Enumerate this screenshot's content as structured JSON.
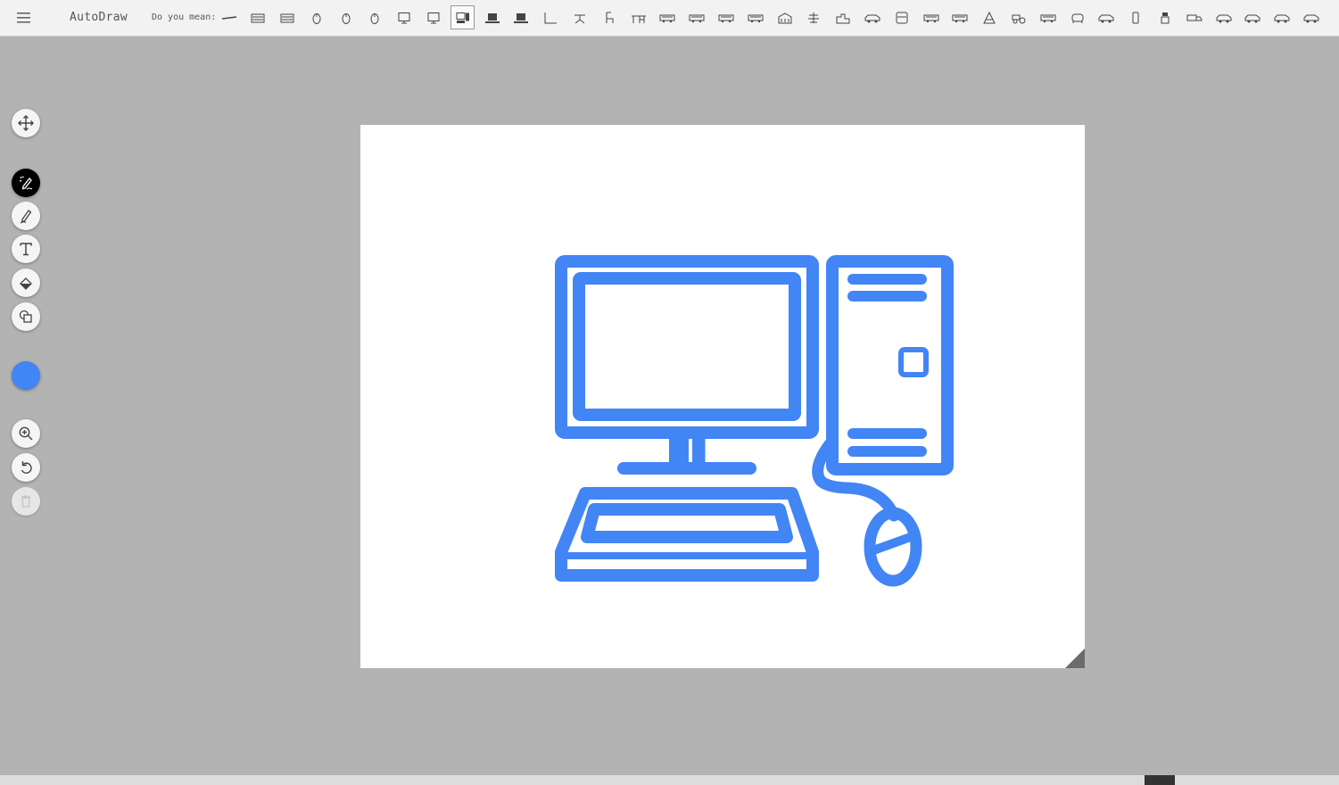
{
  "app": {
    "title": "AutoDraw",
    "menu_icon": "hamburger-menu-icon"
  },
  "suggestions": {
    "label": "Do you mean:",
    "items": [
      {
        "icon": "cable-icon"
      },
      {
        "icon": "keyboard-icon"
      },
      {
        "icon": "keyboard-icon"
      },
      {
        "icon": "mouse-icon"
      },
      {
        "icon": "mouse-icon"
      },
      {
        "icon": "mouse-icon"
      },
      {
        "icon": "monitor-icon"
      },
      {
        "icon": "monitor-icon"
      },
      {
        "icon": "desktop-computer-icon",
        "selected": true
      },
      {
        "icon": "laptop-icon"
      },
      {
        "icon": "laptop-icon"
      },
      {
        "icon": "corner-icon"
      },
      {
        "icon": "stool-icon"
      },
      {
        "icon": "chair-icon"
      },
      {
        "icon": "desk-icon"
      },
      {
        "icon": "bus-icon"
      },
      {
        "icon": "bus-icon"
      },
      {
        "icon": "bus-icon"
      },
      {
        "icon": "bus-icon"
      },
      {
        "icon": "building-icon"
      },
      {
        "icon": "pagoda-icon"
      },
      {
        "icon": "factory-icon"
      },
      {
        "icon": "car-icon"
      },
      {
        "icon": "bus-front-icon"
      },
      {
        "icon": "bus-icon"
      },
      {
        "icon": "bus-icon"
      },
      {
        "icon": "tower-icon"
      },
      {
        "icon": "tractor-icon"
      },
      {
        "icon": "bus-icon"
      },
      {
        "icon": "car-front-icon"
      },
      {
        "icon": "car-icon"
      },
      {
        "icon": "phone-icon"
      },
      {
        "icon": "robot-icon"
      },
      {
        "icon": "truck-icon"
      },
      {
        "icon": "car-icon"
      },
      {
        "icon": "car-icon"
      },
      {
        "icon": "car-icon"
      },
      {
        "icon": "car-icon"
      }
    ]
  },
  "tools": [
    {
      "name": "move-tool",
      "icon": "move-arrows-icon"
    },
    {
      "name": "autodraw-tool",
      "icon": "autodraw-pen-icon",
      "active": true
    },
    {
      "name": "draw-tool",
      "icon": "pencil-icon"
    },
    {
      "name": "type-tool",
      "icon": "text-icon"
    },
    {
      "name": "fill-tool",
      "icon": "paint-bucket-icon"
    },
    {
      "name": "shape-tool",
      "icon": "shapes-icon"
    },
    {
      "name": "zoom-tool",
      "icon": "zoom-in-icon"
    },
    {
      "name": "undo-tool",
      "icon": "undo-icon"
    },
    {
      "name": "delete-tool",
      "icon": "trash-icon",
      "disabled": true
    }
  ],
  "colors": {
    "current_color": "#4285f4",
    "drawing_stroke": "#4285f4",
    "canvas_background": "#ffffff",
    "workspace_background": "#b3b3b3"
  },
  "canvas": {
    "drawing": "desktop-computer-icon"
  }
}
